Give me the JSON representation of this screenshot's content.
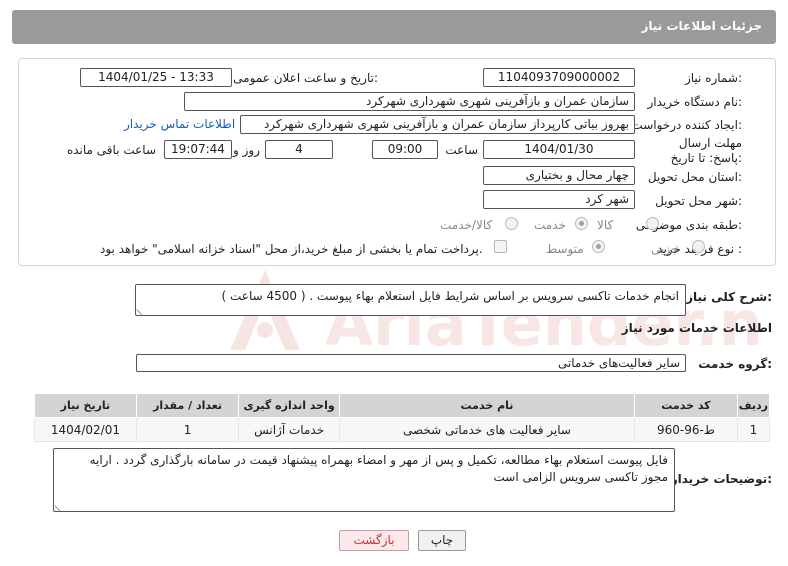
{
  "header": {
    "title": "جزئیات اطلاعات نیاز"
  },
  "watermark": {
    "text": "AriaTender.net"
  },
  "form": {
    "need_number_label": "شماره نیاز:",
    "need_number": "1104093709000002",
    "announce_label": "تاریخ و ساعت اعلان عمومی:",
    "announce_value": "1404/01/25 - 13:33",
    "buyer_org_label": "نام دستگاه خریدار:",
    "buyer_org": "سازمان عمران و بازآفرینی شهری شهرداری شهرکرد",
    "creator_label": "ایجاد کننده درخواست:",
    "creator": "بهروز بیاتی کارپرداز سازمان عمران و بازآفرینی شهری شهرداری شهرکرد",
    "contact_link": "اطلاعات تماس خریدار",
    "deadline_label": "مهلت ارسال پاسخ: تا تاریخ:",
    "deadline_date": "1404/01/30",
    "time_label": "ساعت",
    "deadline_time": "09:00",
    "days_value": "4",
    "days_label": "روز و",
    "remaining_time": "19:07:44",
    "remaining_label": "ساعت باقی مانده",
    "province_label": "استان محل تحویل:",
    "province": "چهار محال و بختیاری",
    "city_label": "شهر محل تحویل:",
    "city": "شهر کرد",
    "category_label": "طبقه بندی موضوعی:",
    "category_options": [
      "کالا",
      "خدمت",
      "کالا/خدمت"
    ],
    "category_selected": "خدمت",
    "process_label": "نوع فرآیند خرید :",
    "process_options": [
      "جزیی",
      "متوسط"
    ],
    "process_selected": "متوسط",
    "payment_note": "پرداخت تمام یا بخشی از مبلغ خرید،از محل \"اسناد خزانه اسلامی\" خواهد بود."
  },
  "summary": {
    "label": "شرح کلی نیاز:",
    "text": "انجام خدمات تاکسی سرویس بر اساس شرایط فایل استعلام بهاء پیوست . ( 4500 ساعت )"
  },
  "services": {
    "section_title": "اطلاعات خدمات مورد نیاز",
    "group_label": "گروه خدمت:",
    "group_value": "سایر فعالیت‌های خدماتی",
    "columns": [
      "ردیف",
      "کد خدمت",
      "نام خدمت",
      "واحد اندازه گیری",
      "تعداد / مقدار",
      "تاریخ نیاز"
    ],
    "rows": [
      [
        "1",
        "ط-96-960",
        "سایر فعالیت های خدماتی شخصی",
        "خدمات آژانس",
        "1",
        "1404/02/01"
      ]
    ]
  },
  "notes": {
    "label": "توضیحات خریدار:",
    "text": "فایل پیوست استعلام بهاء مطالعه، تکمیل و پس از مهر و امضاء بهمراه پیشنهاد قیمت در سامانه بارگذاری گردد . ارایه مجوز تاکسی سرویس الزامی است"
  },
  "buttons": {
    "print": "چاپ",
    "back": "بازگشت"
  },
  "colors": {
    "header_bg": "#9a9a9a",
    "link": "#1a5fb4",
    "back_button_text": "#b53a48"
  }
}
